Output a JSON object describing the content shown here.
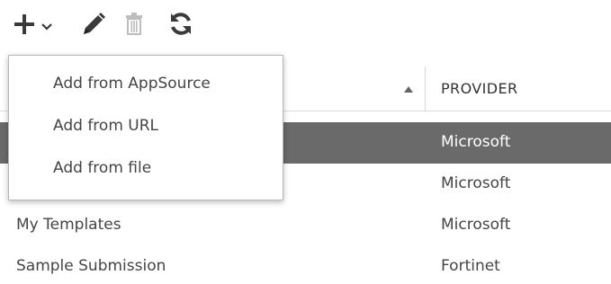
{
  "toolbar": {
    "icons": [
      "plus-icon",
      "chevron-down-icon",
      "pencil-icon",
      "trash-icon",
      "refresh-icon"
    ]
  },
  "add_menu": {
    "items": [
      {
        "label": "Add from AppSource"
      },
      {
        "label": "Add from URL"
      },
      {
        "label": "Add from file"
      }
    ]
  },
  "table": {
    "columns": {
      "name": "",
      "provider": "PROVIDER"
    },
    "sort": "ascending",
    "rows": [
      {
        "name": "",
        "provider": "Microsoft",
        "selected": true
      },
      {
        "name": "",
        "provider": "Microsoft",
        "selected": false
      },
      {
        "name": "My Templates",
        "provider": "Microsoft",
        "selected": false
      },
      {
        "name": "Sample Submission",
        "provider": "Fortinet",
        "selected": false
      }
    ]
  },
  "colors": {
    "selected_row": "#6a6a6a",
    "icon": "#3a3a3a",
    "icon_disabled": "#bdbdbd"
  }
}
